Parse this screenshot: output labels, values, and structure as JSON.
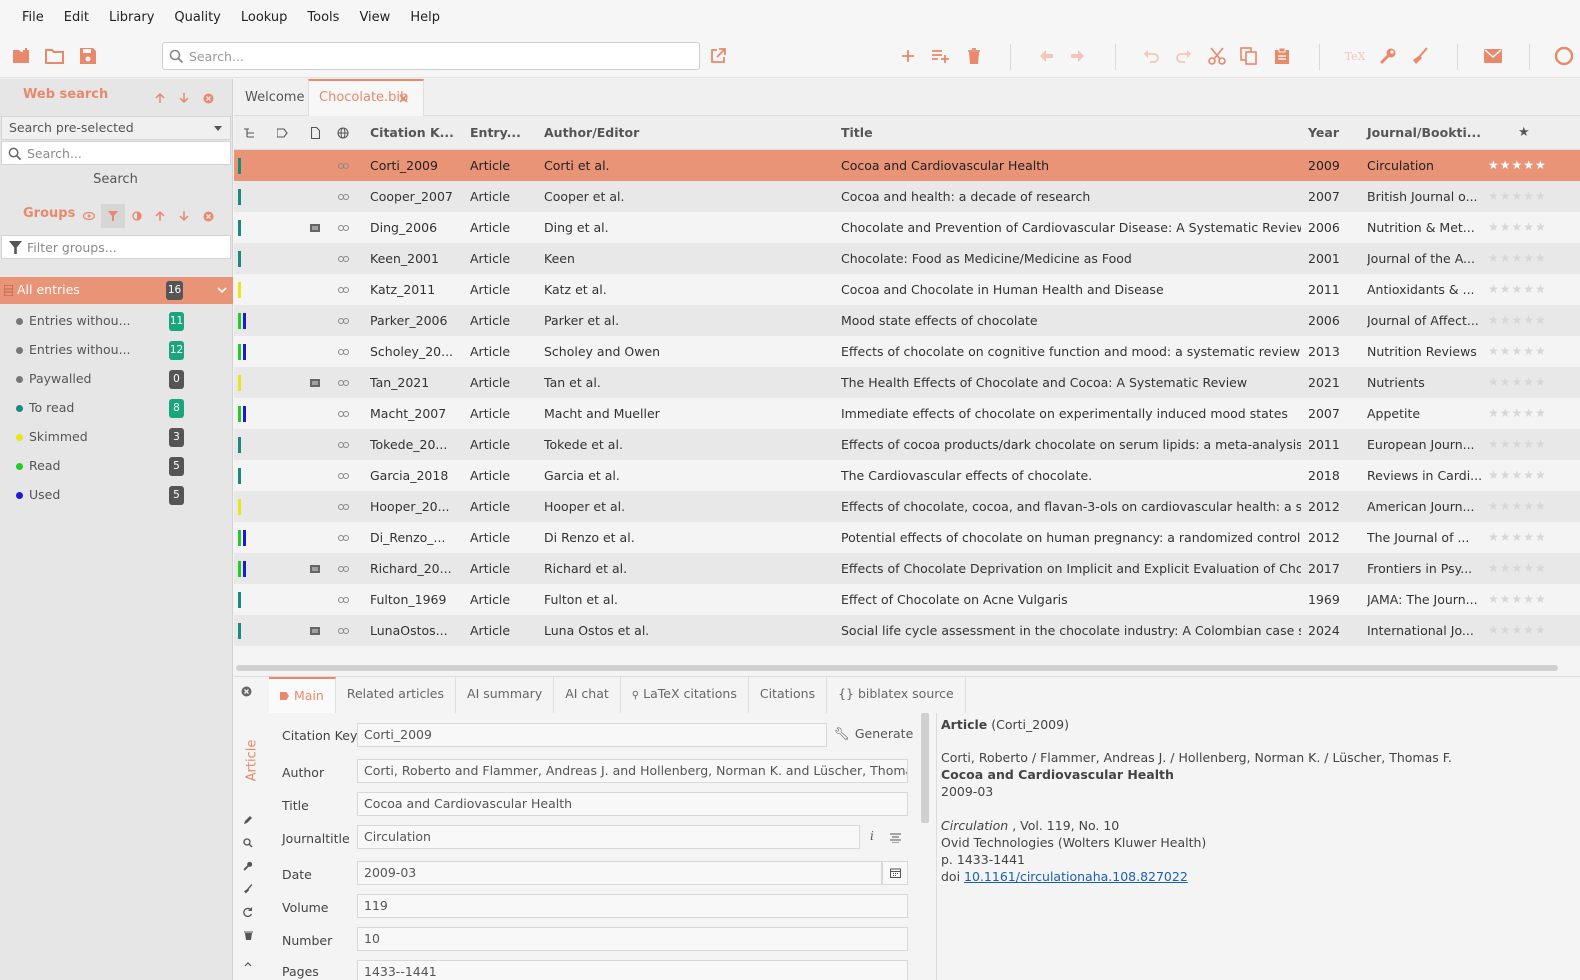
{
  "menubar": {
    "items": [
      "File",
      "Edit",
      "Library",
      "Quality",
      "Lookup",
      "Tools",
      "View",
      "Help"
    ]
  },
  "toolbar": {
    "search_placeholder": "Search..."
  },
  "sidebar": {
    "web_search_title": "Web search",
    "search_preselected": "Search pre-selected",
    "search_placeholder": "Search...",
    "search_button": "Search",
    "groups_title": "Groups",
    "filter_placeholder": "Filter groups...",
    "all_entries": {
      "label": "All entries",
      "count": "16"
    },
    "groups": [
      {
        "label": "Entries withou...",
        "count": "11",
        "dot": "#777777",
        "badge": "#1aa67d"
      },
      {
        "label": "Entries withou...",
        "count": "12",
        "dot": "#777777",
        "badge": "#1aa67d"
      },
      {
        "label": "Paywalled",
        "count": "0",
        "dot": "#777777",
        "badge": "#555555"
      },
      {
        "label": "To read",
        "count": "8",
        "dot": "#1a8a7a",
        "badge": "#1aa67d"
      },
      {
        "label": "Skimmed",
        "count": "3",
        "dot": "#e6e61a",
        "badge": "#555555"
      },
      {
        "label": "Read",
        "count": "5",
        "dot": "#22cc22",
        "badge": "#555555"
      },
      {
        "label": "Used",
        "count": "5",
        "dot": "#1a1ad8",
        "badge": "#555555"
      }
    ]
  },
  "tabs": {
    "welcome": "Welcome",
    "active": "Chocolate.bib"
  },
  "table": {
    "headers": {
      "citation_key": "Citation K...",
      "entry_type": "Entry...",
      "author": "Author/Editor",
      "title": "Title",
      "year": "Year",
      "journal": "Journal/Bookti..."
    },
    "rows": [
      {
        "key": "Corti_2009",
        "type": "Article",
        "author": "Corti et al.",
        "title": "Cocoa and Cardiovascular Health",
        "year": "2009",
        "journal": "Circulation",
        "bars": [
          "#1a8a7a"
        ],
        "file": false
      },
      {
        "key": "Cooper_2007",
        "type": "Article",
        "author": "Cooper et al.",
        "title": "Cocoa and health: a decade of research",
        "year": "2007",
        "journal": "British Journal o...",
        "bars": [
          "#1a8a7a"
        ],
        "file": false
      },
      {
        "key": "Ding_2006",
        "type": "Article",
        "author": "Ding et al.",
        "title": "Chocolate and Prevention of Cardiovascular Disease: A Systematic Review",
        "year": "2006",
        "journal": "Nutrition & Met...",
        "bars": [
          "#1a8a7a"
        ],
        "file": true
      },
      {
        "key": "Keen_2001",
        "type": "Article",
        "author": "Keen",
        "title": "Chocolate: Food as Medicine/Medicine as Food",
        "year": "2001",
        "journal": "Journal of the A...",
        "bars": [
          "#1a8a7a"
        ],
        "file": false
      },
      {
        "key": "Katz_2011",
        "type": "Article",
        "author": "Katz et al.",
        "title": "Cocoa and Chocolate in Human Health and Disease",
        "year": "2011",
        "journal": "Antioxidants & ...",
        "bars": [
          "#e6e61a"
        ],
        "file": false
      },
      {
        "key": "Parker_2006",
        "type": "Article",
        "author": "Parker et al.",
        "title": "Mood state effects of chocolate",
        "year": "2006",
        "journal": "Journal of Affect...",
        "bars": [
          "#22cc22",
          "#1a1ad8"
        ],
        "file": false
      },
      {
        "key": "Scholey_20...",
        "type": "Article",
        "author": "Scholey and Owen",
        "title": "Effects of chocolate on cognitive function and mood: a systematic review",
        "year": "2013",
        "journal": "Nutrition Reviews",
        "bars": [
          "#22cc22",
          "#1a1ad8"
        ],
        "file": false
      },
      {
        "key": "Tan_2021",
        "type": "Article",
        "author": "Tan et al.",
        "title": "The Health Effects of Chocolate and Cocoa: A Systematic Review",
        "year": "2021",
        "journal": "Nutrients",
        "bars": [
          "#e6e61a"
        ],
        "file": true
      },
      {
        "key": "Macht_2007",
        "type": "Article",
        "author": "Macht and Mueller",
        "title": "Immediate effects of chocolate on experimentally induced mood states",
        "year": "2007",
        "journal": "Appetite",
        "bars": [
          "#22cc22",
          "#1a1ad8"
        ],
        "file": false
      },
      {
        "key": "Tokede_20...",
        "type": "Article",
        "author": "Tokede et al.",
        "title": "Effects of cocoa products/dark chocolate on serum lipids: a meta-analysis",
        "year": "2011",
        "journal": "European Journ...",
        "bars": [
          "#1a8a7a"
        ],
        "file": false
      },
      {
        "key": "Garcia_2018",
        "type": "Article",
        "author": "Garcia et al.",
        "title": "The Cardiovascular effects of chocolate.",
        "year": "2018",
        "journal": "Reviews in Cardi...",
        "bars": [
          "#1a8a7a"
        ],
        "file": false
      },
      {
        "key": "Hooper_20...",
        "type": "Article",
        "author": "Hooper et al.",
        "title": "Effects of chocolate, cocoa, and flavan-3-ols on cardiovascular health: a syste...",
        "year": "2012",
        "journal": "American Journ...",
        "bars": [
          "#e6e61a"
        ],
        "file": false
      },
      {
        "key": "Di_Renzo_...",
        "type": "Article",
        "author": "Di Renzo et al.",
        "title": "Potential effects of chocolate on human pregnancy: a randomized controlled...",
        "year": "2012",
        "journal": "The Journal of ...",
        "bars": [
          "#22cc22",
          "#1a1ad8"
        ],
        "file": false
      },
      {
        "key": "Richard_20...",
        "type": "Article",
        "author": "Richard et al.",
        "title": "Effects of Chocolate Deprivation on Implicit and Explicit Evaluation of Chocol...",
        "year": "2017",
        "journal": "Frontiers in Psy...",
        "bars": [
          "#22cc22",
          "#1a1ad8"
        ],
        "file": true
      },
      {
        "key": "Fulton_1969",
        "type": "Article",
        "author": "Fulton et al.",
        "title": "Effect of Chocolate on Acne Vulgaris",
        "year": "1969",
        "journal": "JAMA: The Journ...",
        "bars": [
          "#1a8a7a"
        ],
        "file": false
      },
      {
        "key": "LunaOstos...",
        "type": "Article",
        "author": "Luna Ostos et al.",
        "title": "Social life cycle assessment in the chocolate industry: A Colombian case stud...",
        "year": "2024",
        "journal": "International Jo...",
        "bars": [
          "#1a8a7a"
        ],
        "file": true
      }
    ]
  },
  "detail": {
    "tabs": [
      "Main",
      "Related articles",
      "AI summary",
      "AI chat",
      "LaTeX citations",
      "Citations",
      "{} biblatex source"
    ],
    "entry_type": "Article",
    "generate_label": "Generate",
    "fields": {
      "citation_key": {
        "label": "Citation Key",
        "value": "Corti_2009"
      },
      "author": {
        "label": "Author",
        "value": "Corti, Roberto and Flammer, Andreas J. and Hollenberg, Norman K. and Lüscher, Thomas F."
      },
      "title": {
        "label": "Title",
        "value": "Cocoa and Cardiovascular Health"
      },
      "journaltitle": {
        "label": "Journaltitle",
        "value": "Circulation"
      },
      "date": {
        "label": "Date",
        "value": "2009-03"
      },
      "volume": {
        "label": "Volume",
        "value": "119"
      },
      "number": {
        "label": "Number",
        "value": "10"
      },
      "pages": {
        "label": "Pages",
        "value": "1433--1441"
      }
    },
    "preview": {
      "type": "Article",
      "key": "(Corti_2009)",
      "authors": "Corti, Roberto / Flammer, Andreas J. / Hollenberg, Norman K. / Lüscher, Thomas F.",
      "title": "Cocoa and Cardiovascular Health",
      "date": "2009-03",
      "journal": "Circulation",
      "journal_rest": " , Vol. 119, No. 10",
      "publisher": "Ovid Technologies (Wolters Kluwer Health)",
      "pages": "p. 1433-1441",
      "doi_label": "doi",
      "doi": "10.1161/circulationaha.108.827022"
    }
  },
  "colors": {
    "accent": "#e8896b",
    "selected_row": "#e99377",
    "link": "#1a5fb4"
  }
}
